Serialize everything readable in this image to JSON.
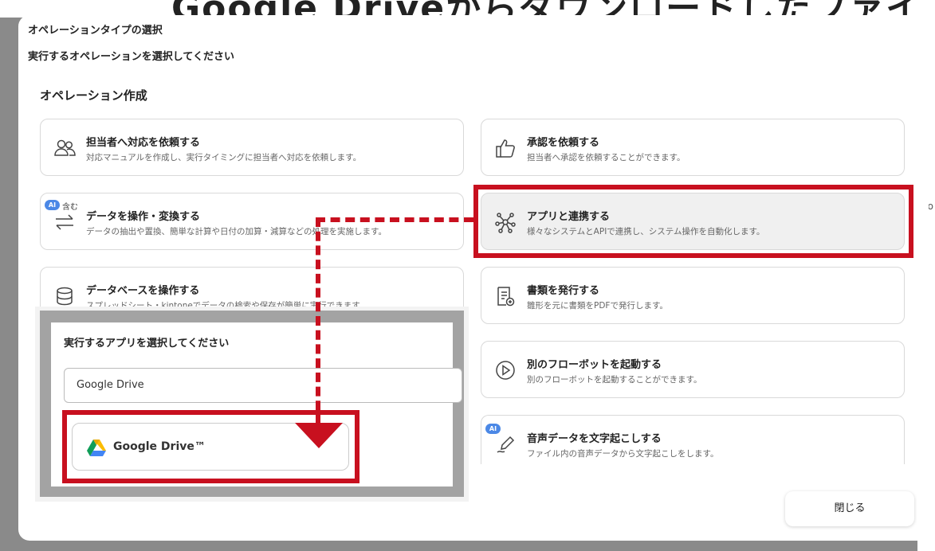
{
  "background": {
    "page_heading_fragment": "Google DriveからダウンロードしたファイルをOC",
    "right_edge_mark": "o"
  },
  "modal": {
    "title": "オペレーションタイプの選択",
    "subtitle": "実行するオペレーションを選択してください",
    "section_title": "オペレーション作成",
    "close_label": "閉じる"
  },
  "cards": {
    "assign_person": {
      "title": "担当者へ対応を依頼する",
      "desc": "対応マニュアルを作成し、実行タイミングに担当者へ対応を依頼します。",
      "icon": "people-icon"
    },
    "approval": {
      "title": "承認を依頼する",
      "desc": "担当者へ承認を依頼することができます。",
      "icon": "thumbs-up-icon"
    },
    "data_transform": {
      "title": "データを操作・変換する",
      "desc": "データの抽出や置換、簡単な計算や日付の加算・減算などの処理を実施します。",
      "icon": "swap-arrows-icon",
      "ai_badge": "AI",
      "ai_extra": "含む"
    },
    "app_integration": {
      "title": "アプリと連携する",
      "desc": "様々なシステムとAPIで連携し、システム操作を自動化します。",
      "icon": "network-nodes-icon"
    },
    "database": {
      "title": "データベースを操作する",
      "desc": "スプレッドシート・kintoneでデータの検索や保存が簡単に実行できます。",
      "icon": "database-icon"
    },
    "document": {
      "title": "書類を発行する",
      "desc": "雛形を元に書類をPDFで発行します。",
      "icon": "document-icon"
    },
    "flowbot": {
      "title": "別のフローボットを起動する",
      "desc": "別のフローボットを起動することができます。",
      "icon": "play-circle-icon"
    },
    "transcribe": {
      "title": "音声データを文字起こしする",
      "desc": "ファイル内の音声データから文字起こしをします。",
      "icon": "pen-icon",
      "ai_badge": "AI"
    }
  },
  "callout": {
    "title": "実行するアプリを選択してください",
    "input_value": "Google Drive",
    "result_label": "Google Drive™",
    "result_icon": "google-drive-icon"
  },
  "colors": {
    "accent_red": "#c8101f",
    "ai_badge_blue": "#4b88e6",
    "highlight_gray": "#f0f0f0"
  }
}
